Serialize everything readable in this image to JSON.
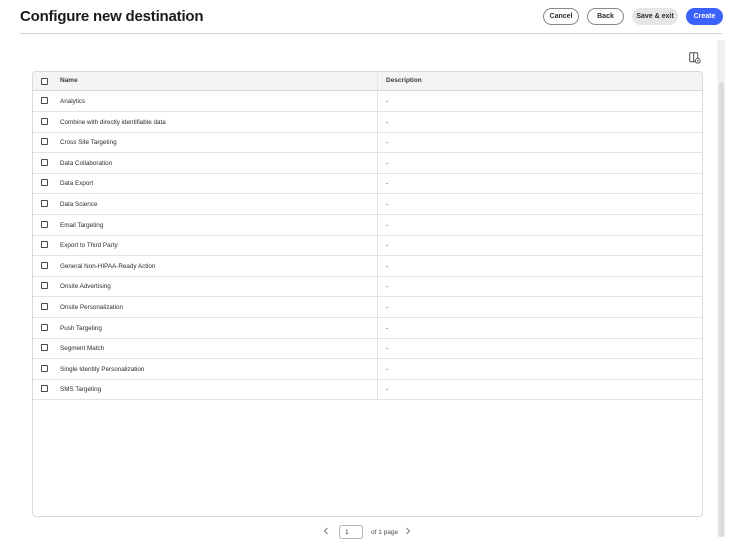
{
  "header": {
    "title": "Configure new destination",
    "cancel_label": "Cancel",
    "back_label": "Back",
    "save_exit_label": "Save & exit",
    "create_label": "Create"
  },
  "table": {
    "columns": [
      "Name",
      "Description"
    ],
    "rows": [
      {
        "name": "Analytics",
        "description": "-"
      },
      {
        "name": "Combine with directly identifiable data",
        "description": "-"
      },
      {
        "name": "Cross Site Targeting",
        "description": "-"
      },
      {
        "name": "Data Collaboration",
        "description": "-"
      },
      {
        "name": "Data Export",
        "description": "-"
      },
      {
        "name": "Data Science",
        "description": "-"
      },
      {
        "name": "Email Targeting",
        "description": "-"
      },
      {
        "name": "Export to Third Party",
        "description": "-"
      },
      {
        "name": "General Non-HIPAA-Ready Action",
        "description": "-"
      },
      {
        "name": "Onsite Advertising",
        "description": "-"
      },
      {
        "name": "Onsite Personalization",
        "description": "-"
      },
      {
        "name": "Push Targeting",
        "description": "-"
      },
      {
        "name": "Segment Match",
        "description": "-"
      },
      {
        "name": "Single Identity Personalization",
        "description": "-"
      },
      {
        "name": "SMS Targeting",
        "description": "-"
      }
    ]
  },
  "pagination": {
    "current_page": "1",
    "of_label": "of 1 page"
  },
  "icons": {
    "column_settings": "column-settings-icon",
    "prev": "chevron-left-icon",
    "next": "chevron-right-icon"
  },
  "colors": {
    "primary": "#3b63fb",
    "secondary_bg": "#e6e6e6"
  }
}
